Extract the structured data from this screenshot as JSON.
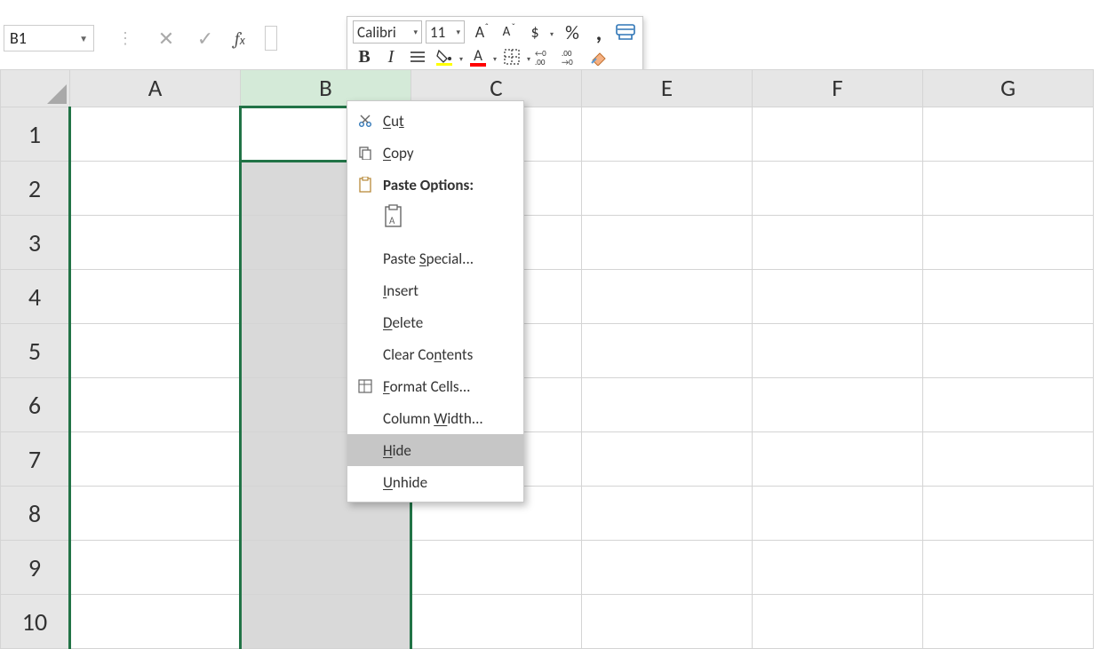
{
  "namebox": {
    "value": "B1"
  },
  "minitoolbar": {
    "font_name": "Calibri",
    "font_size": "11"
  },
  "columns": [
    "A",
    "B",
    "C",
    "E",
    "F",
    "G"
  ],
  "rows": [
    "1",
    "2",
    "3",
    "4",
    "5",
    "6",
    "7",
    "8",
    "9",
    "10"
  ],
  "selected_column": "B",
  "active_cell": "B1",
  "context_menu": {
    "cut": "Cut",
    "copy": "Copy",
    "paste_options": "Paste Options:",
    "paste_special": "Paste Special...",
    "insert": "Insert",
    "delete": "Delete",
    "clear_contents": "Clear Contents",
    "format_cells": "Format Cells...",
    "column_width": "Column Width...",
    "hide": "Hide",
    "unhide": "Unhide"
  }
}
